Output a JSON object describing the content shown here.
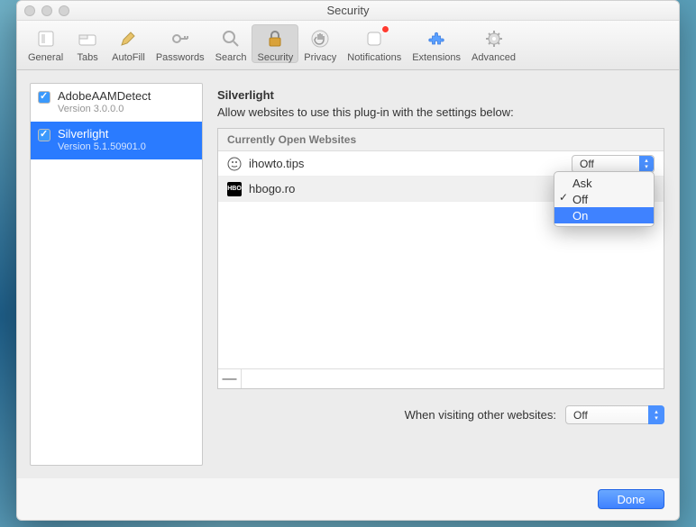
{
  "window": {
    "title": "Security"
  },
  "toolbar": {
    "items": [
      {
        "name": "general",
        "label": "General"
      },
      {
        "name": "tabs",
        "label": "Tabs"
      },
      {
        "name": "autofill",
        "label": "AutoFill"
      },
      {
        "name": "passwords",
        "label": "Passwords"
      },
      {
        "name": "search",
        "label": "Search"
      },
      {
        "name": "security",
        "label": "Security",
        "selected": true
      },
      {
        "name": "privacy",
        "label": "Privacy"
      },
      {
        "name": "notifications",
        "label": "Notifications",
        "badge": true
      },
      {
        "name": "extensions",
        "label": "Extensions"
      },
      {
        "name": "advanced",
        "label": "Advanced"
      }
    ]
  },
  "sidebar": {
    "plugins": [
      {
        "name": "AdobeAAMDetect",
        "version": "Version 3.0.0.0",
        "checked": true,
        "selected": false
      },
      {
        "name": "Silverlight",
        "version": "Version 5.1.50901.0",
        "checked": true,
        "selected": true
      }
    ]
  },
  "detail": {
    "plugin_title": "Silverlight",
    "plugin_subtitle": "Allow websites to use this plug-in with the settings below:",
    "group_header": "Currently Open Websites",
    "sites": [
      {
        "icon": "generic",
        "url": "ihowto.tips",
        "value": "Off"
      },
      {
        "icon": "hbo",
        "url": "hbogo.ro",
        "value": "Off"
      }
    ],
    "remove_button": "—",
    "visiting_label": "When visiting other websites:",
    "visiting_value": "Off"
  },
  "dropdown": {
    "options": [
      "Ask",
      "Off",
      "On"
    ],
    "current": "Off",
    "highlighted": "On"
  },
  "buttons": {
    "done": "Done"
  },
  "icons": {
    "general": "switch",
    "tabs": "tabs",
    "autofill": "pencil",
    "passwords": "key",
    "search": "magnifier",
    "security": "lock",
    "privacy": "hand",
    "notifications": "bell",
    "extensions": "puzzle",
    "advanced": "gear"
  }
}
